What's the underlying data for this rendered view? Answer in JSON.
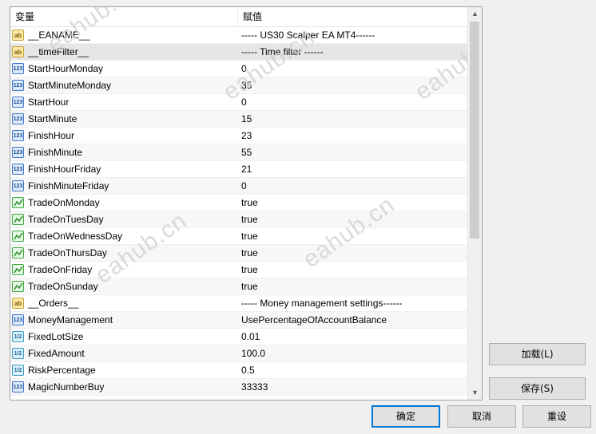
{
  "grid": {
    "columns": {
      "variable": "变量",
      "value": "赋值"
    },
    "rows": [
      {
        "type": "string",
        "name": "__EANAME__",
        "value": "----- US30 Scalper EA MT4------"
      },
      {
        "type": "string",
        "name": "__timeFilter__",
        "value": "----- Time filter ------"
      },
      {
        "type": "int",
        "name": "StartHourMonday",
        "value": "0"
      },
      {
        "type": "int",
        "name": "StartMinuteMonday",
        "value": "35"
      },
      {
        "type": "int",
        "name": "StartHour",
        "value": "0"
      },
      {
        "type": "int",
        "name": "StartMinute",
        "value": "15"
      },
      {
        "type": "int",
        "name": "FinishHour",
        "value": "23"
      },
      {
        "type": "int",
        "name": "FinishMinute",
        "value": "55"
      },
      {
        "type": "int",
        "name": "FinishHourFriday",
        "value": "21"
      },
      {
        "type": "int",
        "name": "FinishMinuteFriday",
        "value": "0"
      },
      {
        "type": "bool",
        "name": "TradeOnMonday",
        "value": "true"
      },
      {
        "type": "bool",
        "name": "TradeOnTuesDay",
        "value": "true"
      },
      {
        "type": "bool",
        "name": "TradeOnWednessDay",
        "value": "true"
      },
      {
        "type": "bool",
        "name": "TradeOnThursDay",
        "value": "true"
      },
      {
        "type": "bool",
        "name": "TradeOnFriday",
        "value": "true"
      },
      {
        "type": "bool",
        "name": "TradeOnSunday",
        "value": "true"
      },
      {
        "type": "string",
        "name": "__Orders__",
        "value": "----- Money management settings------"
      },
      {
        "type": "int",
        "name": "MoneyManagement",
        "value": "UsePercentageOfAccountBalance"
      },
      {
        "type": "double",
        "name": "FixedLotSize",
        "value": "0.01"
      },
      {
        "type": "double",
        "name": "FixedAmount",
        "value": "100.0"
      },
      {
        "type": "double",
        "name": "RiskPercentage",
        "value": "0.5"
      },
      {
        "type": "int",
        "name": "MagicNumberBuy",
        "value": "33333"
      }
    ]
  },
  "icons": {
    "string": "ab",
    "int": "123",
    "double": "1/2"
  },
  "watermark": "eahub.cn",
  "buttons": {
    "load": "加载(L)",
    "save": "保存(S)",
    "ok": "确定",
    "cancel": "取消",
    "reset": "重设"
  },
  "colors": {
    "accent": "#0078d7",
    "selected_row": "#e6e6e6"
  }
}
